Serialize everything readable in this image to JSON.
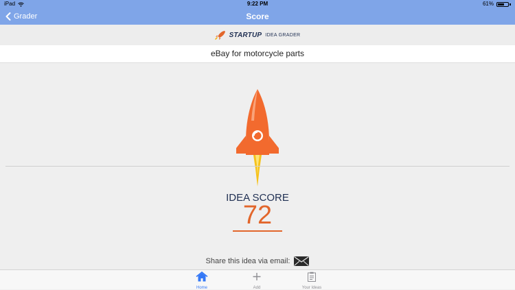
{
  "status_bar": {
    "device": "iPad",
    "time": "9:22 PM",
    "battery": "61%",
    "battery_level": 0.61
  },
  "nav": {
    "back_label": "Grader",
    "title": "Score"
  },
  "brand": {
    "name": "STARTUP",
    "subtitle": "IDEA GRADER"
  },
  "idea": {
    "title": "eBay for motorcycle parts"
  },
  "score": {
    "label": "IDEA SCORE",
    "value": "72"
  },
  "share": {
    "label": "Share this idea via email:"
  },
  "tabs": [
    {
      "label": "Home",
      "icon": "home-icon",
      "active": true
    },
    {
      "label": "Add",
      "icon": "plus-icon",
      "active": false
    },
    {
      "label": "Your Ideas",
      "icon": "clipboard-icon",
      "active": false
    }
  ],
  "colors": {
    "nav": "#7fa5e8",
    "accent": "#e2662b",
    "navy": "#1f2f52",
    "tab_active": "#3478f6"
  }
}
